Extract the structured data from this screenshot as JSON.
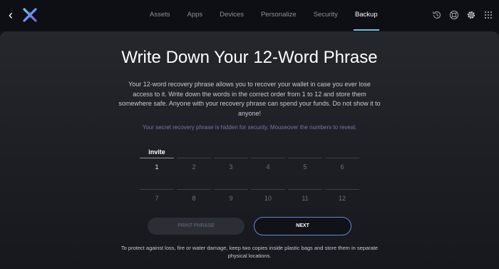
{
  "header": {
    "back_icon": "chevron-left-icon",
    "logo_icon": "exodus-logo-icon",
    "tabs": [
      {
        "label": "Assets",
        "active": false
      },
      {
        "label": "Apps",
        "active": false
      },
      {
        "label": "Devices",
        "active": false
      },
      {
        "label": "Personalize",
        "active": false
      },
      {
        "label": "Security",
        "active": false
      },
      {
        "label": "Backup",
        "active": true
      }
    ],
    "right_icons": [
      "history-icon",
      "help-icon",
      "settings-icon",
      "apps-grid-icon"
    ],
    "accent_color": "#6fc3e3"
  },
  "main": {
    "title": "Write Down Your 12-Word Phrase",
    "description": "Your 12-word recovery phrase allows you to recover your wallet in case you ever lose access to it. Write down the words in the correct order from 1 to 12 and store them somewhere safe. Anyone with your recovery phrase can spend your funds. Do not show it to anyone!",
    "hint": "Your secret recovery phrase is hidden for security. Mouseover the numbers to reveal.",
    "hint_color": "#7d73ad",
    "words": [
      {
        "number": "1",
        "word": "invite"
      },
      {
        "number": "2",
        "word": ""
      },
      {
        "number": "3",
        "word": ""
      },
      {
        "number": "4",
        "word": ""
      },
      {
        "number": "5",
        "word": ""
      },
      {
        "number": "6",
        "word": ""
      },
      {
        "number": "7",
        "word": ""
      },
      {
        "number": "8",
        "word": ""
      },
      {
        "number": "9",
        "word": ""
      },
      {
        "number": "10",
        "word": ""
      },
      {
        "number": "11",
        "word": ""
      },
      {
        "number": "12",
        "word": ""
      }
    ],
    "print_label": "PRINT PHRASE",
    "next_label": "NEXT",
    "footer": "To protect against loss, fire or water damage, keep two copies inside plastic bags and store them in separate physical locations."
  }
}
